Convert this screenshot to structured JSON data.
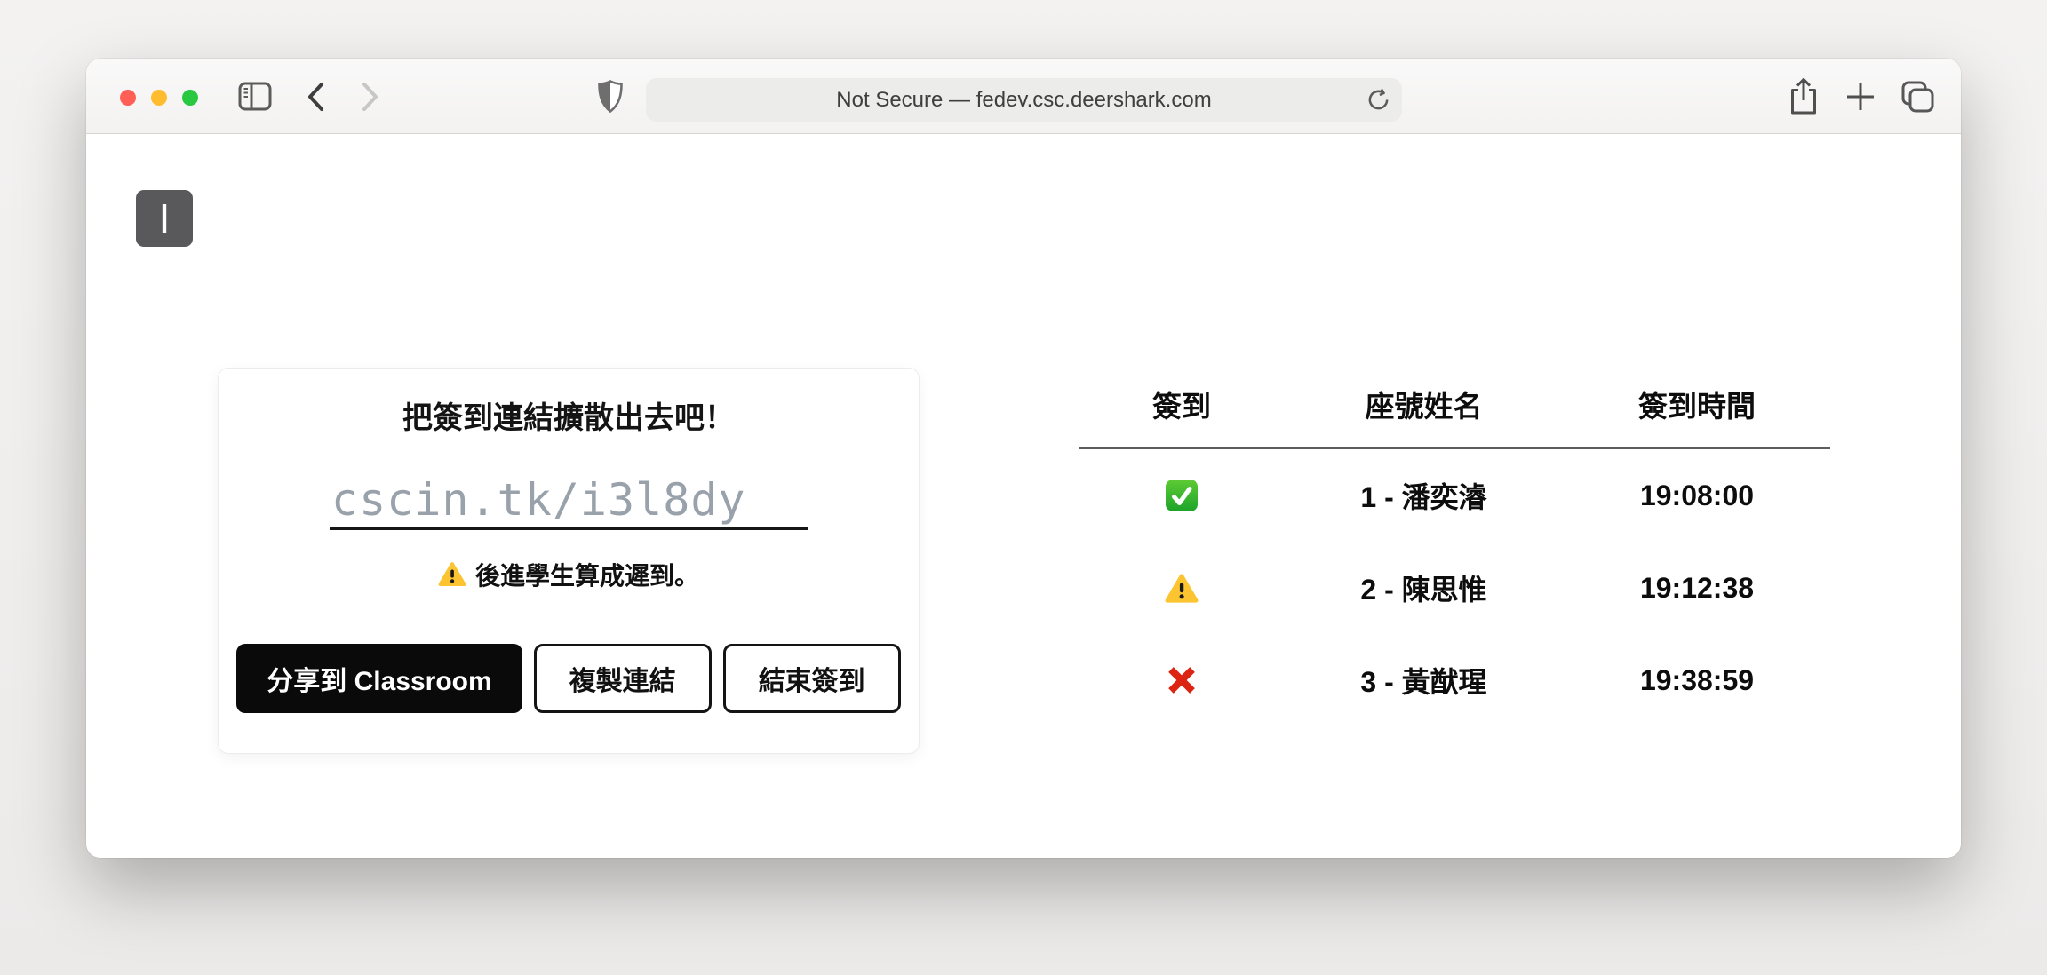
{
  "browser": {
    "address": "Not Secure — fedev.csc.deershark.com"
  },
  "page": {
    "favicon_label": "I",
    "card": {
      "title": "把簽到連結擴散出去吧！",
      "link_text": "cscin.tk/i3l8dy",
      "warning_text": "後進學生算成遲到。",
      "buttons": {
        "share_classroom": "分享到 Classroom",
        "copy_link": "複製連結",
        "end_checkin": "結束簽到"
      }
    },
    "attendance": {
      "headers": [
        "簽到",
        "座號姓名",
        "簽到時間"
      ],
      "rows": [
        {
          "status": "checked-in",
          "name": "1 - 潘奕濬",
          "time": "19:08:00"
        },
        {
          "status": "late",
          "name": "2 - 陳思惟",
          "time": "19:12:38"
        },
        {
          "status": "absent",
          "name": "3 - 黃猷瑆",
          "time": "19:38:59"
        }
      ]
    }
  },
  "colors": {
    "traffic_red": "#ff5f57",
    "traffic_yellow": "#febc2e",
    "traffic_green": "#28c840",
    "status_green": "#2db52d",
    "status_yellow": "#fdc431",
    "status_red": "#dc2413",
    "link_gray": "#99a1ab"
  }
}
